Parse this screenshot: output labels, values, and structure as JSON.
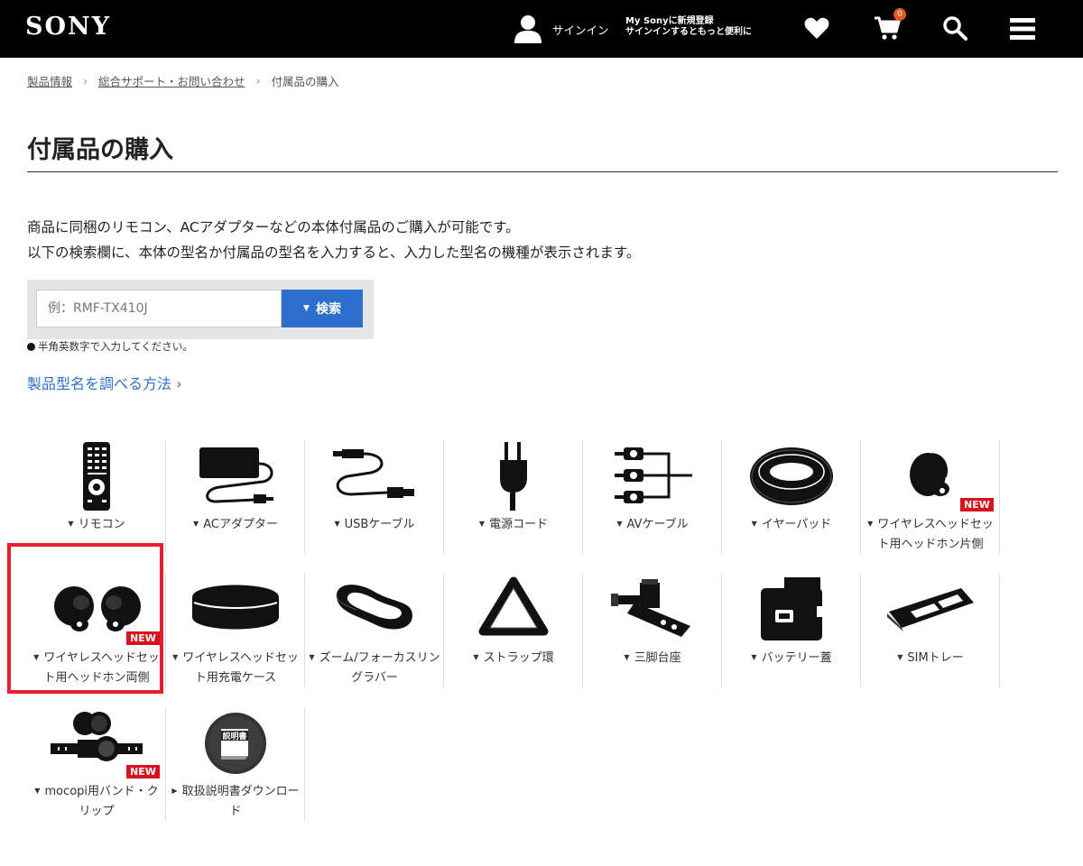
{
  "header": {
    "logo": "SONY",
    "signin": "サインイン",
    "mysony_line1": "My Sonyに新規登録",
    "mysony_line2": "サインインするともっと便利に",
    "cart_count": "0",
    "icons": [
      "user-icon",
      "heart-icon",
      "cart-icon",
      "search-icon",
      "menu-icon"
    ]
  },
  "breadcrumb": {
    "item1": "製品情報",
    "item2": "総合サポート・お問い合わせ",
    "current": "付属品の購入",
    "separator": "›"
  },
  "page_title": "付属品の購入",
  "description": {
    "line1": "商品に同梱のリモコン、ACアダプターなどの本体付属品のご購入が可能です。",
    "line2": "以下の検索欄に、本体の型名か付属品の型名を入力すると、入力した型名の機種が表示されます。"
  },
  "search": {
    "placeholder": "例：RMF-TX410J",
    "button_label": "検索",
    "note": "半角英数字で入力してください。"
  },
  "howto_link": "製品型名を調べる方法 ›",
  "badge_new": "NEW",
  "categories": [
    {
      "label": "リモコン",
      "icon": "remote-icon"
    },
    {
      "label": "ACアダプター",
      "icon": "ac-adapter-icon"
    },
    {
      "label": "USBケーブル",
      "icon": "usb-cable-icon"
    },
    {
      "label": "電源コード",
      "icon": "power-cord-icon"
    },
    {
      "label": "AVケーブル",
      "icon": "av-cable-icon"
    },
    {
      "label": "イヤーパッド",
      "icon": "earpad-icon"
    },
    {
      "label": "ワイヤレスヘッドセット用ヘッドホン片側",
      "icon": "single-earbud-icon",
      "badge": "NEW"
    },
    {
      "label": "ワイヤレスヘッドセット用ヘッドホン両側",
      "icon": "earbuds-icon",
      "badge": "NEW"
    },
    {
      "label": "ワイヤレスヘッドセット用充電ケース",
      "icon": "charging-case-icon"
    },
    {
      "label": "ズーム/フォーカスリングラバー",
      "icon": "ring-rubber-icon"
    },
    {
      "label": "ストラップ環",
      "icon": "strap-ring-icon"
    },
    {
      "label": "三脚台座",
      "icon": "tripod-mount-icon"
    },
    {
      "label": "バッテリー蓋",
      "icon": "battery-cover-icon"
    },
    {
      "label": "SIMトレー",
      "icon": "sim-tray-icon"
    },
    {
      "label": "mocopi用バンド・クリップ",
      "icon": "mocopi-band-icon",
      "badge": "NEW"
    },
    {
      "label": "取扱説明書ダウンロード",
      "icon": "manual-icon",
      "badge_text": "説明書"
    }
  ],
  "colors": {
    "header_bg": "#000000",
    "accent_blue": "#2c6fcd",
    "new_badge": "#d8121b",
    "highlight_border": "#e5202e",
    "cart_badge": "#e05a1b"
  }
}
